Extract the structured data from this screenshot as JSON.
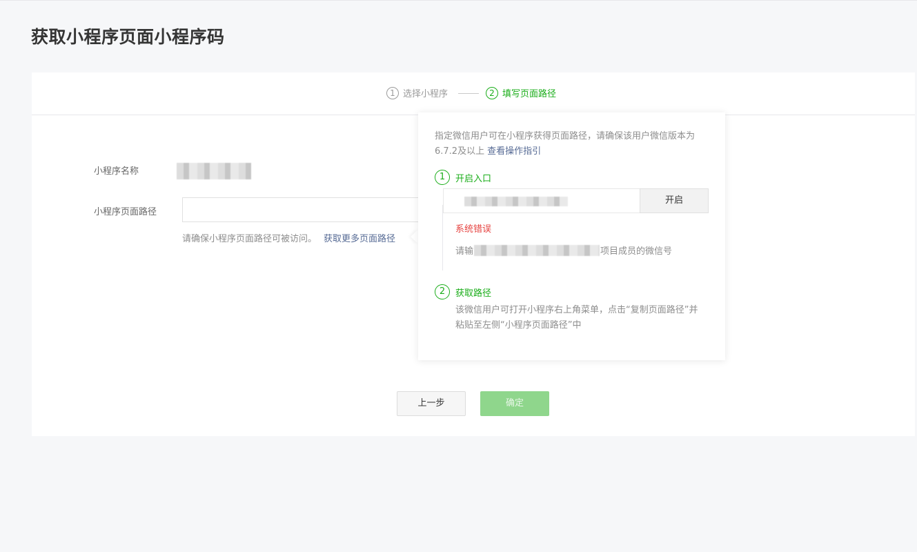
{
  "page": {
    "title": "获取小程序页面小程序码"
  },
  "steps": [
    {
      "num": "1",
      "label": "选择小程序",
      "active": false
    },
    {
      "num": "2",
      "label": "填写页面路径",
      "active": true
    }
  ],
  "form": {
    "name_label": "小程序名称",
    "path_label": "小程序页面路径",
    "path_value": "",
    "hint": "请确保小程序页面路径可被访问。",
    "hint_link": "获取更多页面路径"
  },
  "buttons": {
    "prev": "上一步",
    "confirm": "确定"
  },
  "popover": {
    "desc": "指定微信用户可在小程序获得页面路径，请确保该用户微信版本为6.7.2及以上",
    "desc_link": "查看操作指引",
    "step1": {
      "num": "1",
      "label": "开启入口"
    },
    "open_button": "开启",
    "error_title": "系统错误",
    "error_prefix": "请输",
    "error_suffix": "项目成员的微信号",
    "step2": {
      "num": "2",
      "label": "获取路径"
    },
    "step2_desc": "该微信用户可打开小程序右上角菜单，点击“复制页面路径”并粘贴至左侧“小程序页面路径”中"
  },
  "colors": {
    "primary_green": "#1aad19",
    "link_blue": "#576b95",
    "error_red": "#e64340"
  }
}
